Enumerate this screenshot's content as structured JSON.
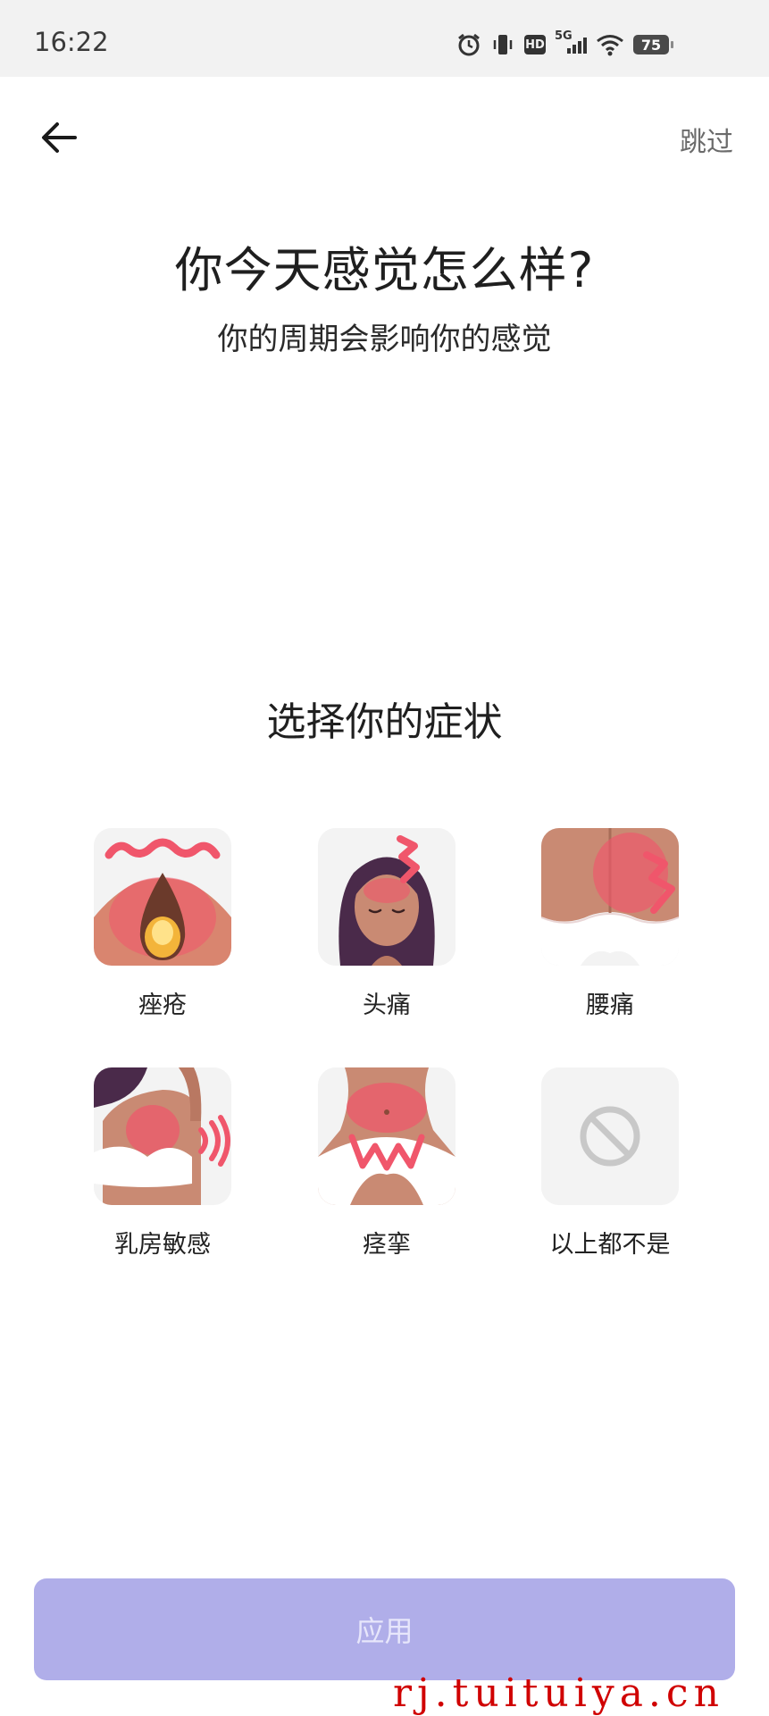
{
  "status_bar": {
    "time": "16:22",
    "network": "5G",
    "hd_label": "HD",
    "battery": "75",
    "icons": [
      "alarm-icon",
      "vibrate-icon",
      "hd-icon",
      "signal-5g-icon",
      "wifi-icon",
      "battery-icon"
    ]
  },
  "header": {
    "back_icon": "arrow-left-icon",
    "skip_label": "跳过"
  },
  "intro": {
    "title": "你今天感觉怎么样?",
    "subtitle": "你的周期会影响你的感觉"
  },
  "symptoms": {
    "section_title": "选择你的症状",
    "items": [
      {
        "label": "痤疮",
        "icon": "acne-icon"
      },
      {
        "label": "头痛",
        "icon": "headache-icon"
      },
      {
        "label": "腰痛",
        "icon": "back-pain-icon"
      },
      {
        "label": "乳房敏感",
        "icon": "breast-sensitivity-icon"
      },
      {
        "label": "痉挛",
        "icon": "cramps-icon"
      },
      {
        "label": "以上都不是",
        "icon": "none-icon"
      }
    ]
  },
  "footer": {
    "apply_label": "应用"
  },
  "watermark": "rj.tuituiya.cn",
  "colors": {
    "accent": "#b0aee9",
    "accent_text": "#e7e6fb",
    "symptom_red": "#f0566b",
    "skin": "#c98a73",
    "tile_bg": "#f3f3f3"
  }
}
